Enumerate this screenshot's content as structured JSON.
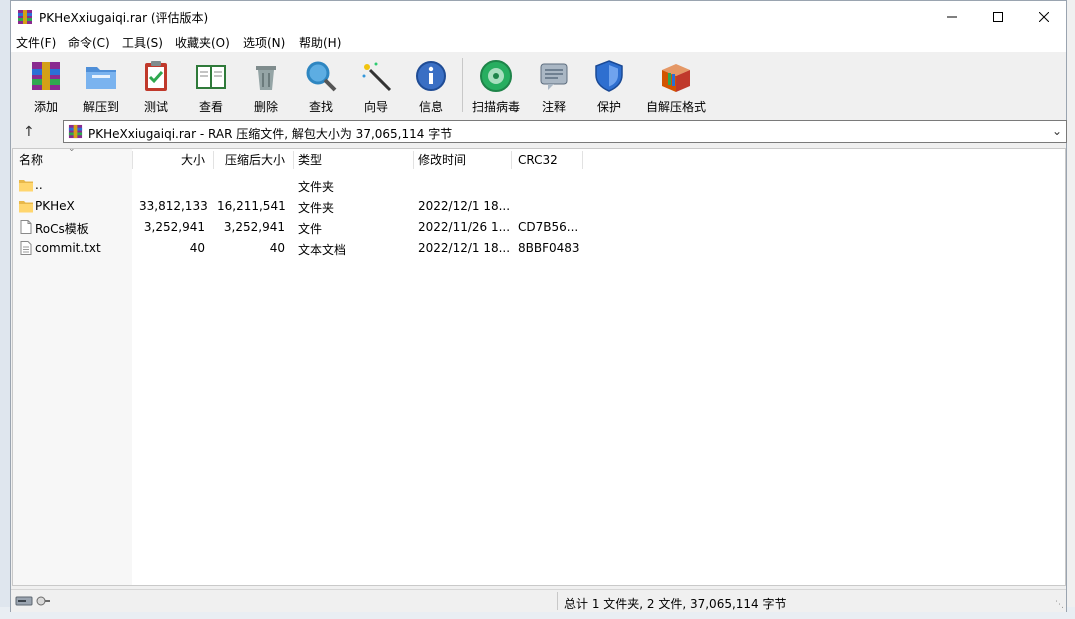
{
  "window": {
    "title": "PKHeXxiugaiqi.rar (评估版本)"
  },
  "menu": [
    "文件(F)",
    "命令(C)",
    "工具(S)",
    "收藏夹(O)",
    "选项(N)",
    "帮助(H)"
  ],
  "toolbar": {
    "add": "添加",
    "extract": "解压到",
    "test": "测试",
    "view": "查看",
    "delete": "删除",
    "find": "查找",
    "wizard": "向导",
    "info": "信息",
    "virus_scan": "扫描病毒",
    "comment": "注释",
    "protect": "保护",
    "sfx": "自解压格式"
  },
  "address": {
    "text": "PKHeXxiugaiqi.rar - RAR 压缩文件, 解包大小为 37,065,114 字节"
  },
  "columns": {
    "name": "名称",
    "size": "大小",
    "packed": "压缩后大小",
    "type": "类型",
    "modified": "修改时间",
    "crc": "CRC32"
  },
  "files": [
    {
      "name": "..",
      "size": "",
      "packed": "",
      "type": "文件夹",
      "modified": "",
      "crc": "",
      "icon": "folder-icon"
    },
    {
      "name": "PKHeX",
      "size": "33,812,133",
      "packed": "16,211,541",
      "type": "文件夹",
      "modified": "2022/12/1 18...",
      "crc": "",
      "icon": "folder-icon"
    },
    {
      "name": "RoCs模板",
      "size": "3,252,941",
      "packed": "3,252,941",
      "type": "文件",
      "modified": "2022/11/26 1...",
      "crc": "CD7B56...",
      "icon": "blank-file-icon"
    },
    {
      "name": "commit.txt",
      "size": "40",
      "packed": "40",
      "type": "文本文档",
      "modified": "2022/12/1 18...",
      "crc": "8BBF0483",
      "icon": "text-file-icon"
    }
  ],
  "status": {
    "summary": "总计 1 文件夹, 2 文件, 37,065,114 字节"
  },
  "colors": {
    "accent": "#0078d7",
    "folder": "#ffd66e",
    "window_bg": "#f0f0f0"
  }
}
